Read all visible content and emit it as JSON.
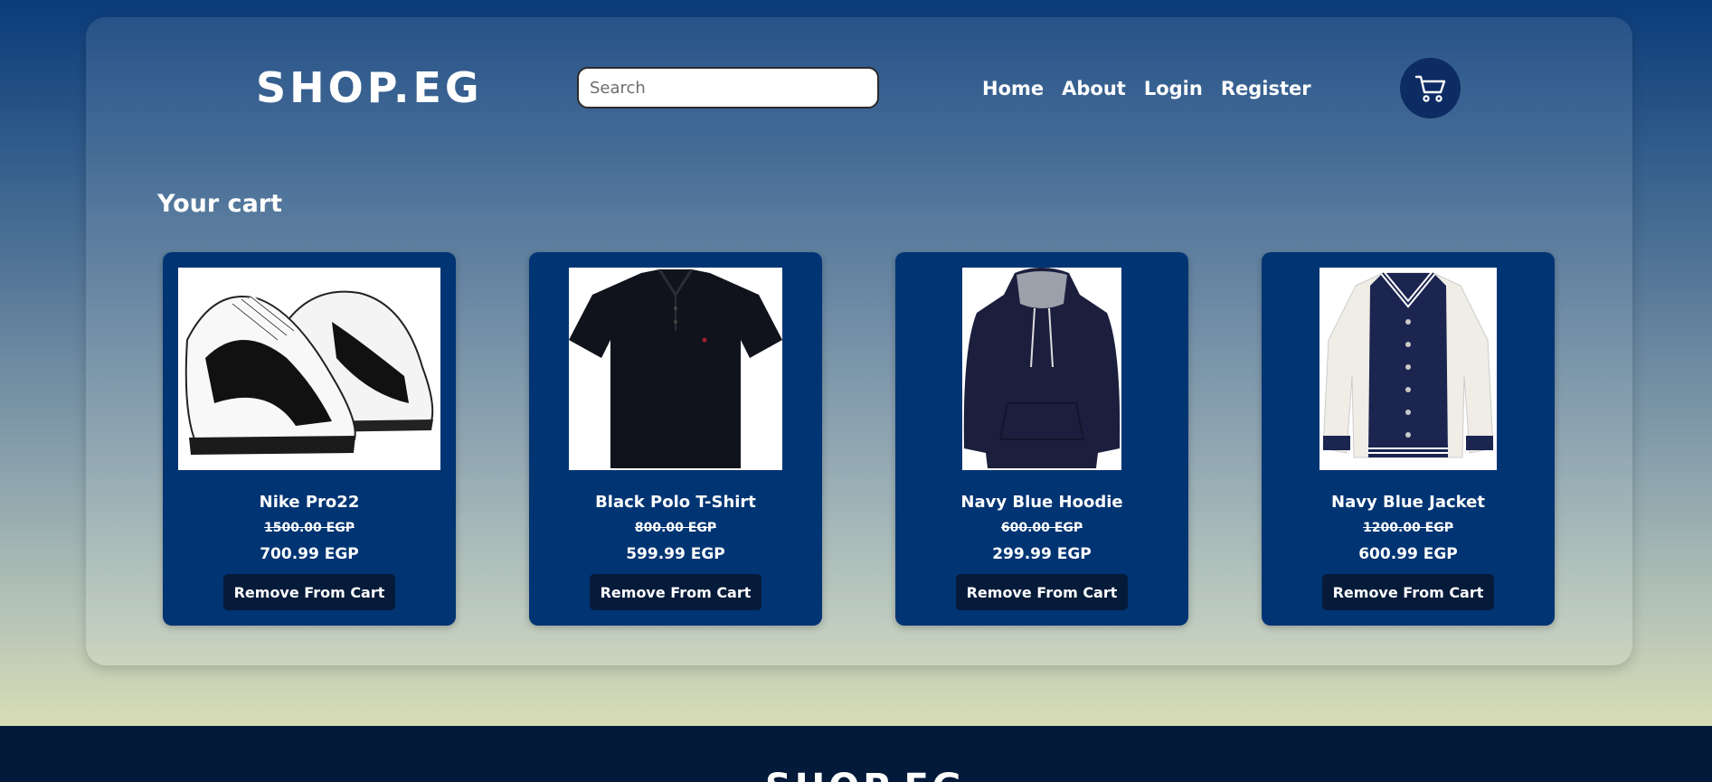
{
  "header": {
    "logo": "SHOP.EG",
    "search_placeholder": "Search",
    "nav": [
      "Home",
      "About",
      "Login",
      "Register"
    ],
    "cart_icon": "cart-icon"
  },
  "main": {
    "title": "Your cart",
    "products": [
      {
        "name": "Nike Pro22",
        "old_price": "1500.00 EGP",
        "price": "700.99 EGP",
        "button": "Remove From Cart",
        "image": "sneakers-image"
      },
      {
        "name": "Black Polo T-Shirt",
        "old_price": "800.00 EGP",
        "price": "599.99 EGP",
        "button": "Remove From Cart",
        "image": "polo-shirt-image"
      },
      {
        "name": "Navy Blue Hoodie",
        "old_price": "600.00 EGP",
        "price": "299.99 EGP",
        "button": "Remove From Cart",
        "image": "hoodie-image"
      },
      {
        "name": "Navy Blue Jacket",
        "old_price": "1200.00 EGP",
        "price": "600.99 EGP",
        "button": "Remove From Cart",
        "image": "jacket-image"
      }
    ]
  },
  "footer": {
    "logo": "SHOP.EG"
  },
  "colors": {
    "card_bg": "#003473",
    "button_bg": "#061b3a",
    "cart_button_bg": "#0d2c63",
    "footer_bg": "#031a3a"
  }
}
